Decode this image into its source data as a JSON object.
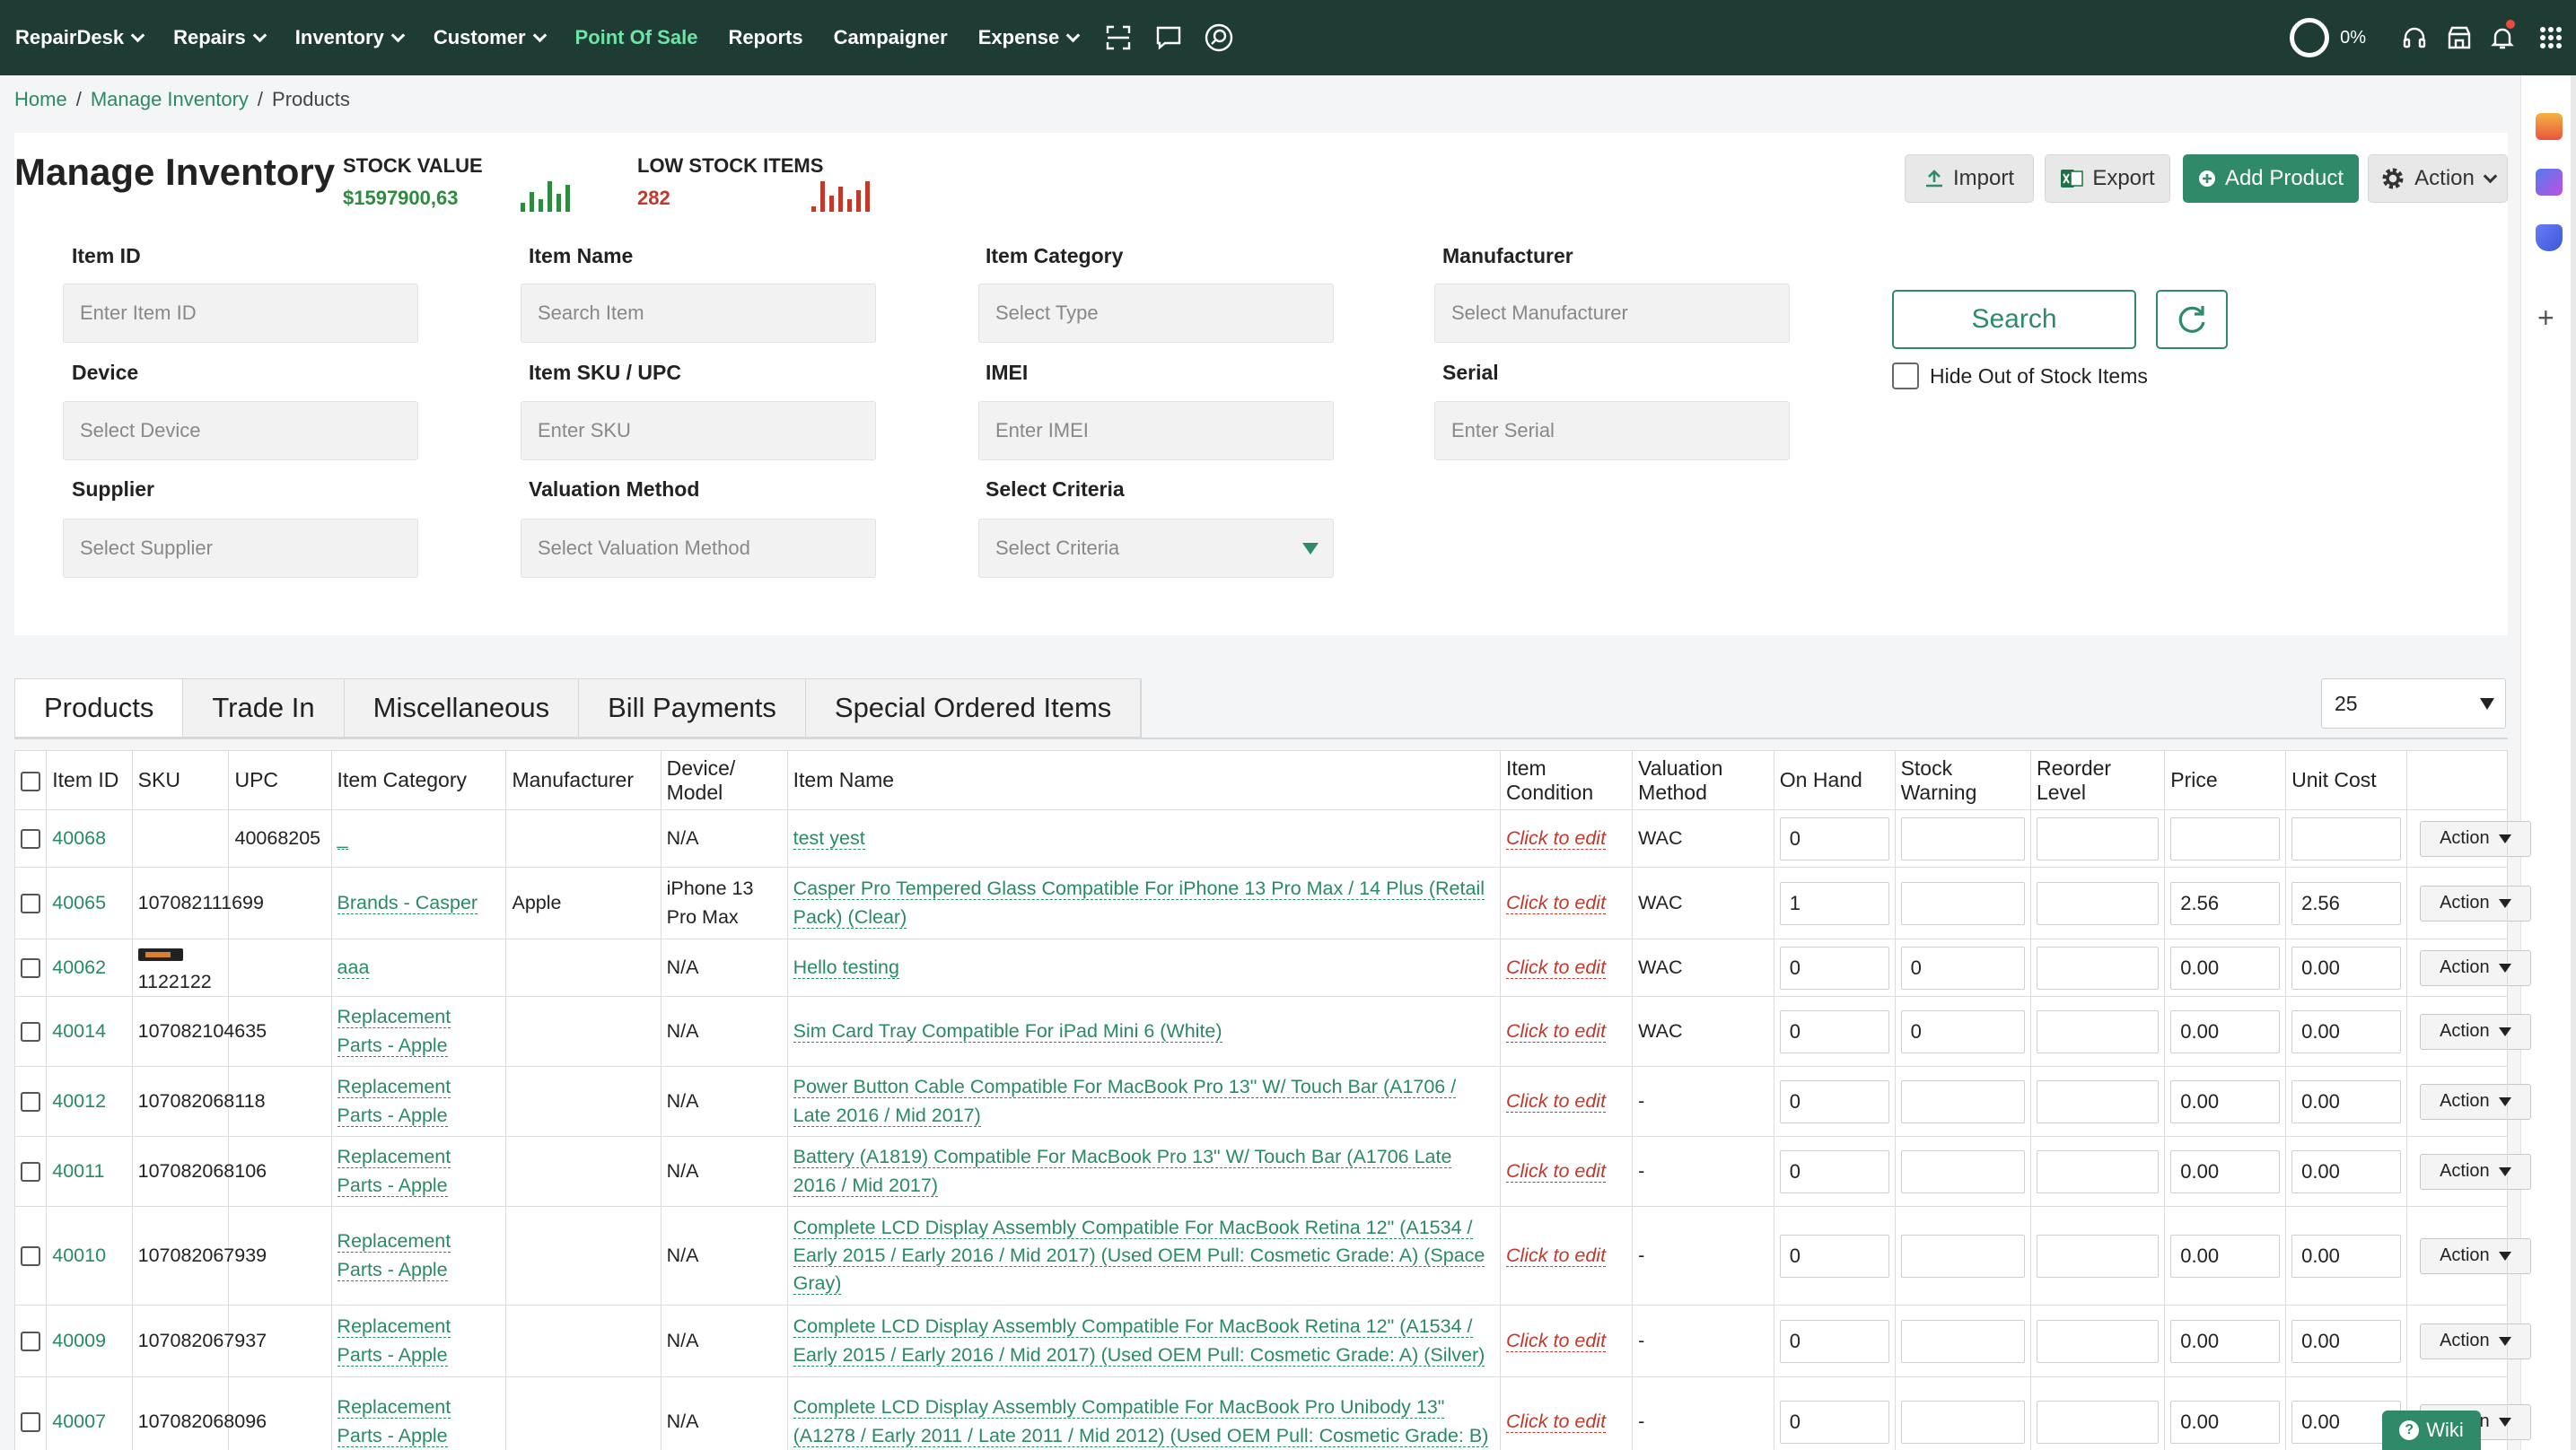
{
  "nav": {
    "brand": "RepairDesk",
    "items": [
      "Repairs",
      "Inventory",
      "Customer"
    ],
    "pos": "Point Of Sale",
    "reports": "Reports",
    "campaigner": "Campaigner",
    "expense": "Expense",
    "progress": "0%"
  },
  "breadcrumb": {
    "home": "Home",
    "manage": "Manage Inventory",
    "current": "Products"
  },
  "header": {
    "title": "Manage Inventory",
    "stock_value_label": "STOCK VALUE",
    "stock_value": "$1597900,63",
    "low_stock_label": "LOW STOCK ITEMS",
    "low_stock": "282",
    "import": "Import",
    "export": "Export",
    "add_product": "Add Product",
    "action": "Action"
  },
  "filters": {
    "item_id": {
      "label": "Item ID",
      "placeholder": "Enter Item ID"
    },
    "item_name": {
      "label": "Item Name",
      "placeholder": "Search Item"
    },
    "item_category": {
      "label": "Item Category",
      "placeholder": "Select Type"
    },
    "manufacturer": {
      "label": "Manufacturer",
      "placeholder": "Select Manufacturer"
    },
    "device": {
      "label": "Device",
      "placeholder": "Select Device"
    },
    "sku": {
      "label": "Item SKU / UPC",
      "placeholder": "Enter SKU"
    },
    "imei": {
      "label": "IMEI",
      "placeholder": "Enter IMEI"
    },
    "serial": {
      "label": "Serial",
      "placeholder": "Enter Serial"
    },
    "supplier": {
      "label": "Supplier",
      "placeholder": "Select Supplier"
    },
    "valuation": {
      "label": "Valuation Method",
      "placeholder": "Select Valuation Method"
    },
    "criteria": {
      "label": "Select Criteria",
      "placeholder": "Select Criteria"
    },
    "search": "Search",
    "hide_oos": "Hide Out of Stock Items"
  },
  "tabs": [
    "Products",
    "Trade In",
    "Miscellaneous",
    "Bill Payments",
    "Special Ordered Items"
  ],
  "per_page": "25",
  "table": {
    "headers": [
      "Item ID",
      "SKU",
      "UPC",
      "Item Category",
      "Manufacturer",
      "Device/ Model",
      "Item Name",
      "Item Condition",
      "Valuation Method",
      "On Hand",
      "Stock Warning",
      "Reorder Level",
      "Price",
      "Unit Cost"
    ],
    "click_to_edit": "Click to edit",
    "action": "Action",
    "rows": [
      {
        "id": "40068",
        "sku": "",
        "upc": "40068205",
        "category": "_",
        "manufacturer": "",
        "device": "N/A",
        "name": "test yest",
        "valuation": "WAC",
        "on_hand": "0",
        "warning": "",
        "reorder": "",
        "price": "",
        "cost": ""
      },
      {
        "id": "40065",
        "sku": "107082111699",
        "upc": "",
        "category": "Brands - Casper",
        "manufacturer": "Apple",
        "device": "iPhone 13 Pro Max",
        "name": "Casper Pro Tempered Glass Compatible For iPhone 13 Pro Max / 14 Plus (Retail Pack) (Clear)",
        "valuation": "WAC",
        "on_hand": "1",
        "warning": "",
        "reorder": "",
        "price": "2.56",
        "cost": "2.56"
      },
      {
        "id": "40062",
        "sku": "1122122",
        "upc": "",
        "category": "aaa",
        "manufacturer": "",
        "device": "N/A",
        "name": "Hello testing",
        "valuation": "WAC",
        "on_hand": "0",
        "warning": "0",
        "reorder": "",
        "price": "0.00",
        "cost": "0.00"
      },
      {
        "id": "40014",
        "sku": "107082104635",
        "upc": "",
        "category": "Replacement Parts - Apple",
        "manufacturer": "",
        "device": "N/A",
        "name": "Sim Card Tray Compatible For iPad Mini 6 (White)",
        "valuation": "WAC",
        "on_hand": "0",
        "warning": "0",
        "reorder": "",
        "price": "0.00",
        "cost": "0.00"
      },
      {
        "id": "40012",
        "sku": "107082068118",
        "upc": "",
        "category": "Replacement Parts - Apple",
        "manufacturer": "",
        "device": "N/A",
        "name": "Power Button Cable Compatible For MacBook Pro 13\" W/ Touch Bar (A1706 / Late 2016 / Mid 2017)",
        "valuation": "-",
        "on_hand": "0",
        "warning": "",
        "reorder": "",
        "price": "0.00",
        "cost": "0.00"
      },
      {
        "id": "40011",
        "sku": "107082068106",
        "upc": "",
        "category": "Replacement Parts - Apple",
        "manufacturer": "",
        "device": "N/A",
        "name": "Battery (A1819) Compatible For MacBook Pro 13\" W/ Touch Bar (A1706 Late 2016 / Mid 2017)",
        "valuation": "-",
        "on_hand": "0",
        "warning": "",
        "reorder": "",
        "price": "0.00",
        "cost": "0.00"
      },
      {
        "id": "40010",
        "sku": "107082067939",
        "upc": "",
        "category": "Replacement Parts - Apple",
        "manufacturer": "",
        "device": "N/A",
        "name": "Complete LCD Display Assembly Compatible For MacBook Retina 12\" (A1534 / Early 2015 / Early 2016 / Mid 2017) (Used OEM Pull: Cosmetic Grade: A) (Space Gray)",
        "valuation": "-",
        "on_hand": "0",
        "warning": "",
        "reorder": "",
        "price": "0.00",
        "cost": "0.00"
      },
      {
        "id": "40009",
        "sku": "107082067937",
        "upc": "",
        "category": "Replacement Parts - Apple",
        "manufacturer": "",
        "device": "N/A",
        "name": "Complete LCD Display Assembly Compatible For MacBook Retina 12\" (A1534 / Early 2015 / Early 2016 / Mid 2017) (Used OEM Pull: Cosmetic Grade: A) (Silver)",
        "valuation": "-",
        "on_hand": "0",
        "warning": "",
        "reorder": "",
        "price": "0.00",
        "cost": "0.00"
      },
      {
        "id": "40007",
        "sku": "107082068096",
        "upc": "",
        "category": "Replacement Parts - Apple",
        "manufacturer": "",
        "device": "N/A",
        "name": "Complete LCD Display Assembly Compatible For MacBook Pro Unibody 13\" (A1278 / Early 2011 / Late 2011 / Mid 2012) (Used OEM Pull: Cosmetic Grade: B)",
        "valuation": "-",
        "on_hand": "0",
        "warning": "",
        "reorder": "",
        "price": "0.00",
        "cost": "0.00"
      }
    ]
  },
  "wiki": "Wiki"
}
